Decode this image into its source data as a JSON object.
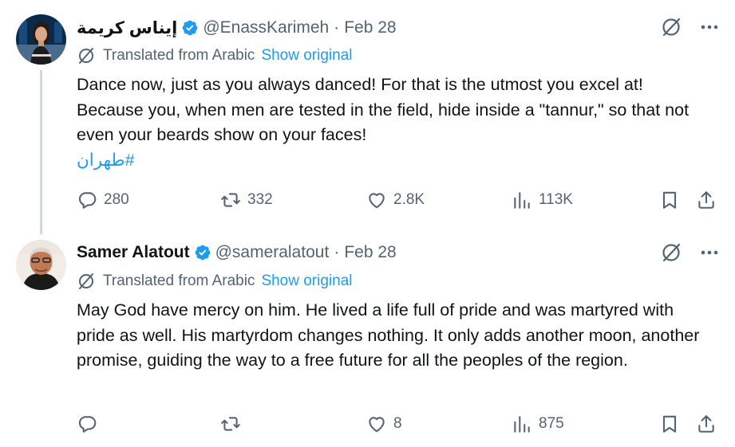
{
  "tweets": [
    {
      "display_name": "إيناس كريمة",
      "handle": "@EnassKarimeh",
      "separator": "·",
      "date": "Feb 28",
      "translated_label": "Translated from Arabic",
      "show_original": "Show original",
      "text": "Dance now, just as you always danced! For that is the utmost you excel at! Because you, when men are tested in the field, hide inside a \"tannur,\" so that not even your beards show on your faces!",
      "hashtag": "#طهران",
      "replies": "280",
      "reposts": "332",
      "likes": "2.8K",
      "views": "113K"
    },
    {
      "display_name": "Samer Alatout",
      "handle": "@sameralatout",
      "separator": "·",
      "date": "Feb 28",
      "translated_label": "Translated from Arabic",
      "show_original": "Show original",
      "text": "May God have mercy on him. He lived a life full of pride and was martyred with pride as well. His martyrdom changes nothing. It only adds another moon, another promise, guiding the way to a free future for all the peoples of the region.",
      "replies": "",
      "reposts": "",
      "likes": "8",
      "views": "875"
    }
  ],
  "colors": {
    "text": "#0f1419",
    "secondary": "#536471",
    "accent": "#1d9bf0",
    "thread_line": "#cfd9de"
  },
  "icons": {
    "verified": "verified-badge-icon",
    "grok": "grok-icon",
    "more": "more-icon",
    "translate": "translate-icon",
    "reply": "reply-icon",
    "repost": "repost-icon",
    "like": "like-icon",
    "views": "views-icon",
    "bookmark": "bookmark-icon",
    "share": "share-icon"
  }
}
